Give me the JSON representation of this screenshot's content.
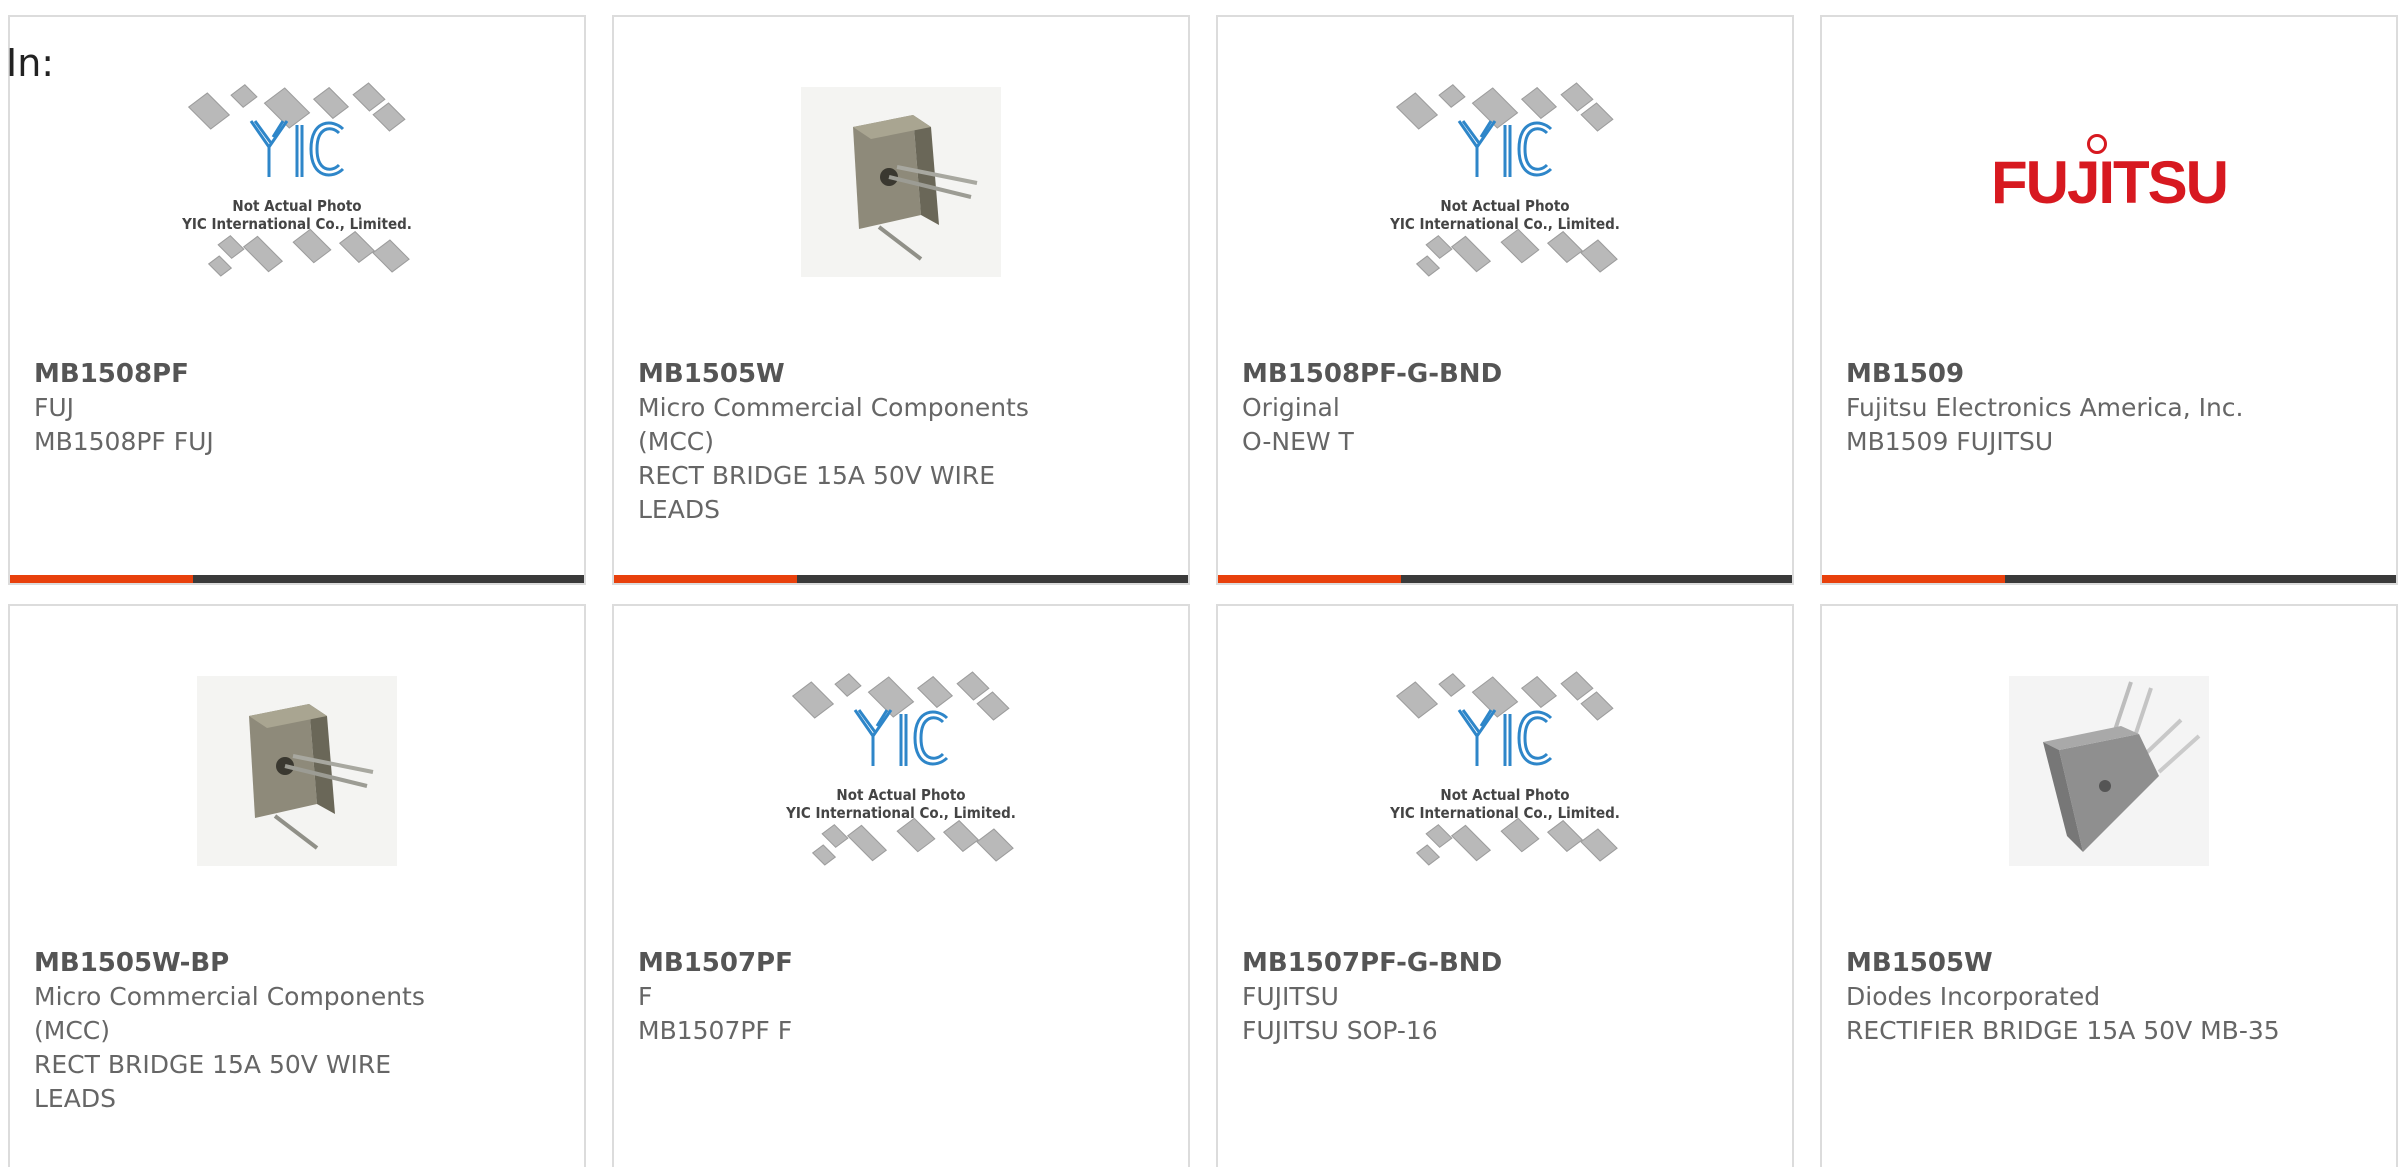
{
  "page": {
    "label": "In:"
  },
  "colors": {
    "accent": "#e8400c",
    "bar": "#3a3a3a",
    "brand_fujitsu": "#d71920",
    "yic_blue": "#2e86c9"
  },
  "placeholder": {
    "line1": "Not Actual Photo",
    "line2": "YIC International Co., Limited."
  },
  "products": [
    {
      "part": "MB1508PF",
      "maker": "FUJ",
      "desc": "MB1508PF FUJ",
      "image": "yic-placeholder-icon"
    },
    {
      "part": "MB1505W",
      "maker": "Micro Commercial Components (MCC)",
      "desc": "RECT BRIDGE 15A 50V WIRE LEADS",
      "image": "bridge-rectifier-photo-icon"
    },
    {
      "part": "MB1508PF-G-BND",
      "maker": "Original",
      "desc": "O-NEW T",
      "image": "yic-placeholder-icon"
    },
    {
      "part": "MB1509",
      "maker": "Fujitsu Electronics America, Inc.",
      "desc": "MB1509 FUJITSU",
      "image": "fujitsu-logo-icon",
      "logo_text": "FUJITSU"
    },
    {
      "part": "MB1505W-BP",
      "maker": "Micro Commercial Components (MCC)",
      "desc": "RECT BRIDGE 15A 50V WIRE LEADS",
      "image": "bridge-rectifier-photo-icon"
    },
    {
      "part": "MB1507PF",
      "maker": "F",
      "desc": "MB1507PF F",
      "image": "yic-placeholder-icon"
    },
    {
      "part": "MB1507PF-G-BND",
      "maker": "FUJITSU",
      "desc": "FUJITSU SOP-16",
      "image": "yic-placeholder-icon"
    },
    {
      "part": "MB1505W",
      "maker": "Diodes Incorporated",
      "desc": "RECTIFIER BRIDGE 15A 50V MB-35",
      "image": "bridge-rectifier-gray-photo-icon"
    }
  ]
}
